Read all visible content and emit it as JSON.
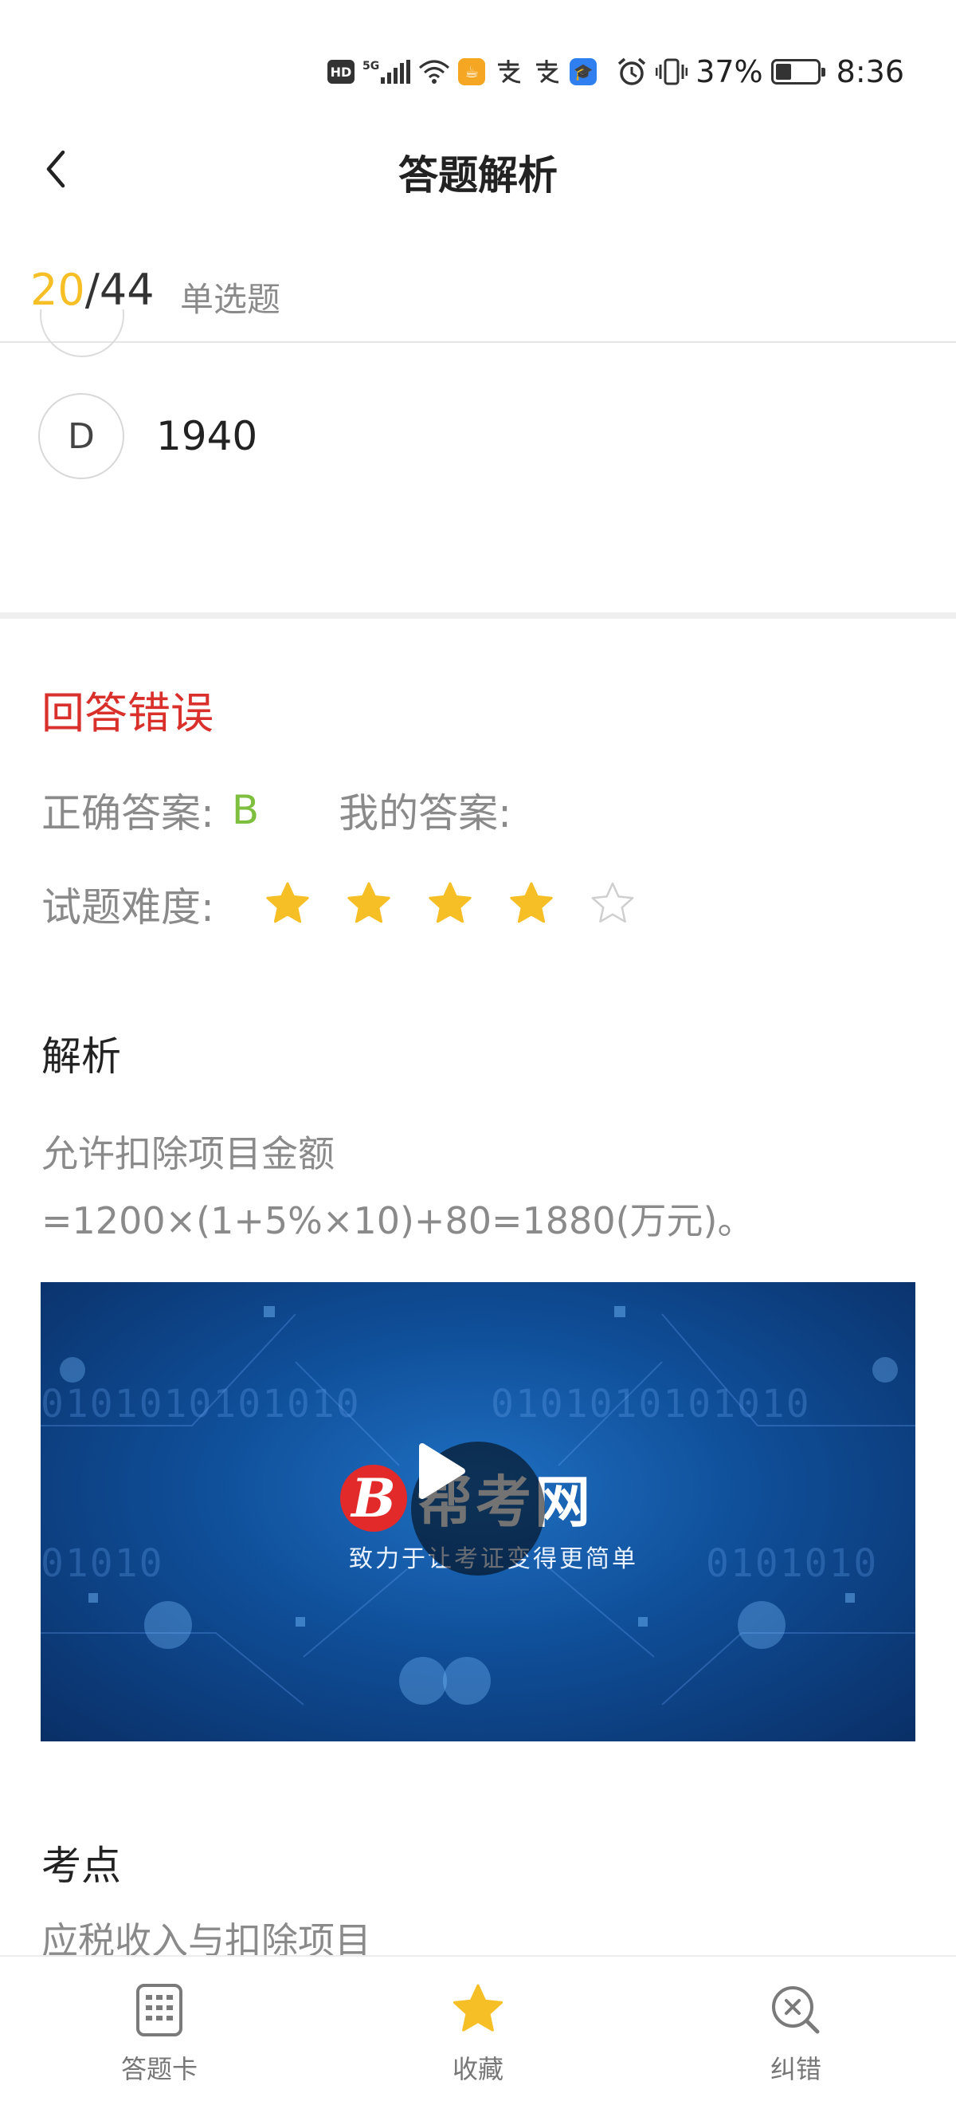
{
  "status_bar": {
    "hd_badge": "HD",
    "network": "5G",
    "battery_percent": "37%",
    "battery_level": 0.37,
    "time": "8:36",
    "icons": [
      "hd-icon",
      "signal-icon",
      "wifi-icon",
      "app-notification-icon",
      "alipay-icon",
      "alipay-icon",
      "app-notification-icon",
      "alarm-icon",
      "vibrate-icon",
      "battery-icon"
    ]
  },
  "header": {
    "title": "答题解析",
    "back_icon": "back-arrow-icon"
  },
  "question": {
    "current": "20",
    "separator": "/",
    "total": "44",
    "type": "单选题"
  },
  "option_d": {
    "letter": "D",
    "text": "1940"
  },
  "result": {
    "status": "回答错误",
    "correct_label": "正确答案:",
    "correct_value": "B",
    "my_label": "我的答案:",
    "my_value": "",
    "difficulty_label": "试题难度:",
    "difficulty": 4,
    "difficulty_max": 5
  },
  "analysis": {
    "title": "解析",
    "line1": "允许扣除项目金额",
    "line2": "=1200×(1+5%×10)+80=1880(万元)。"
  },
  "video": {
    "brand": "帮考网",
    "brand_letter": "B",
    "slogan": "致力于让考证变得更简单",
    "binary_a": "0101010101010",
    "binary_b": "0101010101010",
    "binary_c": "01010",
    "binary_d": "0101010"
  },
  "key_point": {
    "title": "考点",
    "text": "应税收入与扣除项目"
  },
  "bottom_nav": {
    "card": "答题卡",
    "favorite": "收藏",
    "correction": "纠错"
  },
  "colors": {
    "accent_yellow": "#f6bf26",
    "error_red": "#d9302c",
    "correct_green": "#7fbf3f",
    "muted_gray": "#8a8a8a"
  }
}
